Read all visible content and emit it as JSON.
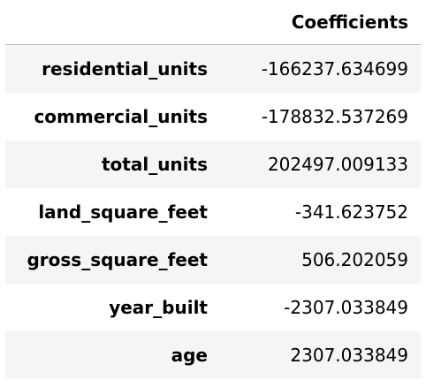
{
  "table": {
    "index_header": "",
    "value_header": "Coefficients",
    "rows": [
      {
        "label": "residential_units",
        "value": "-166237.634699"
      },
      {
        "label": "commercial_units",
        "value": "-178832.537269"
      },
      {
        "label": "total_units",
        "value": "202497.009133"
      },
      {
        "label": "land_square_feet",
        "value": "-341.623752"
      },
      {
        "label": "gross_square_feet",
        "value": "506.202059"
      },
      {
        "label": "year_built",
        "value": "-2307.033849"
      },
      {
        "label": "age",
        "value": "2307.033849"
      }
    ]
  }
}
